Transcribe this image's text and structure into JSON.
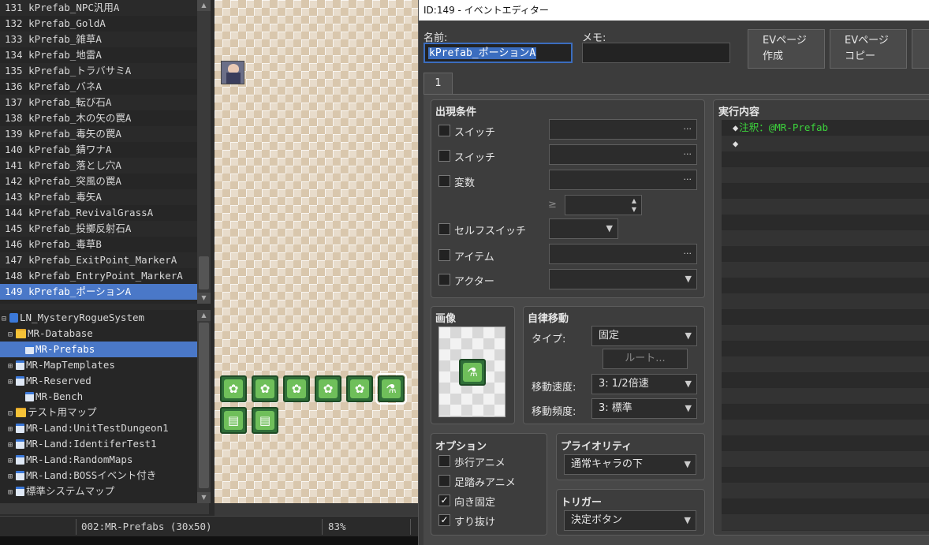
{
  "event_list": {
    "items": [
      {
        "id": "131",
        "name": "kPrefab_NPC汎用A"
      },
      {
        "id": "132",
        "name": "kPrefab_GoldA"
      },
      {
        "id": "133",
        "name": "kPrefab_雑草A"
      },
      {
        "id": "134",
        "name": "kPrefab_地雷A"
      },
      {
        "id": "135",
        "name": "kPrefab_トラバサミA"
      },
      {
        "id": "136",
        "name": "kPrefab_バネA"
      },
      {
        "id": "137",
        "name": "kPrefab_転び石A"
      },
      {
        "id": "138",
        "name": "kPrefab_木の矢の罠A"
      },
      {
        "id": "139",
        "name": "kPrefab_毒矢の罠A"
      },
      {
        "id": "140",
        "name": "kPrefab_錆ワナA"
      },
      {
        "id": "141",
        "name": "kPrefab_落とし穴A"
      },
      {
        "id": "142",
        "name": "kPrefab_突風の罠A"
      },
      {
        "id": "143",
        "name": "kPrefab_毒矢A"
      },
      {
        "id": "144",
        "name": "kPrefab_RevivalGrassA"
      },
      {
        "id": "145",
        "name": "kPrefab_投擲反射石A"
      },
      {
        "id": "146",
        "name": "kPrefab_毒草B"
      },
      {
        "id": "147",
        "name": "kPrefab_ExitPoint_MarkerA"
      },
      {
        "id": "148",
        "name": "kPrefab_EntryPoint_MarkerA"
      },
      {
        "id": "149",
        "name": "kPrefab_ポーションA"
      }
    ]
  },
  "map_tree": {
    "items": [
      {
        "toggle": "⊟",
        "icon": "proj",
        "label": "LN_MysteryRogueSystem"
      },
      {
        "toggle": "⊟",
        "icon": "folder",
        "label": "MR-Database"
      },
      {
        "toggle": "",
        "icon": "map",
        "label": "MR-Prefabs"
      },
      {
        "toggle": "⊞",
        "icon": "map",
        "label": "MR-MapTemplates"
      },
      {
        "toggle": "⊞",
        "icon": "map",
        "label": "MR-Reserved"
      },
      {
        "toggle": "",
        "icon": "map",
        "label": "MR-Bench"
      },
      {
        "toggle": "⊟",
        "icon": "folder",
        "label": "テスト用マップ"
      },
      {
        "toggle": "⊞",
        "icon": "map",
        "label": "MR-Land:UnitTestDungeon1"
      },
      {
        "toggle": "⊞",
        "icon": "map",
        "label": "MR-Land:IdentiferTest1"
      },
      {
        "toggle": "⊞",
        "icon": "map",
        "label": "MR-Land:RandomMaps"
      },
      {
        "toggle": "⊞",
        "icon": "map",
        "label": "MR-Land:BOSSイベント付き"
      },
      {
        "toggle": "⊞",
        "icon": "map",
        "label": "標準システムマップ"
      }
    ]
  },
  "status_bar": {
    "map": "002:MR-Prefabs (30x50)",
    "zoom": "83%"
  },
  "editor": {
    "title": "ID:149 - イベントエディター",
    "name_label": "名前:",
    "name_value": "kPrefab_ポーションA",
    "memo_label": "メモ:",
    "memo_value": "",
    "btn_new_page_1": "EVページ",
    "btn_new_page_2": "作成",
    "btn_copy_page_1": "EVページ",
    "btn_copy_page_2": "コピー",
    "tab_1": "1",
    "conditions": {
      "title": "出現条件",
      "switch1": "スイッチ",
      "switch2": "スイッチ",
      "variable": "変数",
      "gte": "≥",
      "self_switch": "セルフスイッチ",
      "item": "アイテム",
      "actor": "アクター"
    },
    "image": {
      "title": "画像"
    },
    "autonomous": {
      "title": "自律移動",
      "type_label": "タイプ:",
      "type_value": "固定",
      "route_btn": "ルート...",
      "speed_label": "移動速度:",
      "speed_value": "3: 1/2倍速",
      "freq_label": "移動頻度:",
      "freq_value": "3: 標準"
    },
    "options": {
      "title": "オプション",
      "walk_anime": "歩行アニメ",
      "step_anime": "足踏みアニメ",
      "direction_fix": "向き固定",
      "through": "すり抜け",
      "walk_anime_checked": false,
      "step_anime_checked": false,
      "direction_fix_checked": true,
      "through_checked": true
    },
    "priority": {
      "title": "プライオリティ",
      "value": "通常キャラの下"
    },
    "trigger": {
      "title": "トリガー",
      "value": "決定ボタン"
    },
    "contents": {
      "title": "実行内容",
      "comment": "注釈：@MR-Prefab"
    }
  }
}
